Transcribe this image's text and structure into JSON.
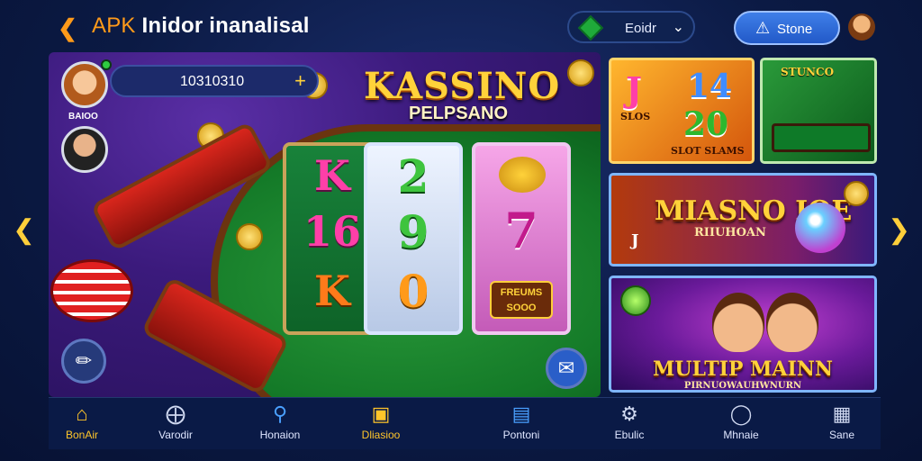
{
  "header": {
    "back_icon": "chevron-left-icon",
    "app_prefix": "APK",
    "app_name": "Inidor inanalisal",
    "selector_label": "Eoidr",
    "selector_icon": "gem-icon",
    "store_label": "Stone",
    "store_icon": "warning-icon",
    "profile_icon": "avatar-icon"
  },
  "main": {
    "player": {
      "value": "10310310",
      "avatar1_name": "BAIOO"
    },
    "logo": {
      "title": "KASSINO",
      "subtitle": "PELPSANO"
    },
    "reels": [
      [
        "K",
        "16",
        "K"
      ],
      [
        "2",
        "9",
        "0"
      ],
      [
        "",
        "7",
        ""
      ]
    ],
    "bonus": {
      "line1": "FREUMS",
      "line2": "SOOO"
    }
  },
  "cards": [
    {
      "top_left": "J",
      "top_right": "14",
      "middle": "20",
      "left_label": "SLOS",
      "bottom": "SLOT SLAMS"
    },
    {
      "label": "STUNCO"
    },
    {
      "title": "MIASNO IOE",
      "subtitle": "RIIUHOAN",
      "left_label": "J"
    },
    {
      "title": "MULTIP MAINN",
      "subtitle": "PIRNUOWAUHWNURN"
    }
  ],
  "bottom_nav": [
    {
      "label": "BonAir",
      "icon": "home-icon",
      "active": true
    },
    {
      "label": "Varodir",
      "icon": "compass-icon",
      "active": false
    },
    {
      "label": "Honaion",
      "icon": "search-icon",
      "active": false
    },
    {
      "label": "Dliasioo",
      "icon": "chest-icon",
      "active": true
    },
    {
      "label": "Pontoni",
      "icon": "clipboard-icon",
      "active": false
    },
    {
      "label": "Ebulic",
      "icon": "gear-icon",
      "active": false
    },
    {
      "label": "Mhnaie",
      "icon": "chat-icon",
      "active": false
    },
    {
      "label": "Sane",
      "icon": "grid-icon",
      "active": false
    }
  ],
  "colors": {
    "accent": "#ffc52a",
    "background": "#0b1a44",
    "store_button": "#2f6ad8"
  }
}
